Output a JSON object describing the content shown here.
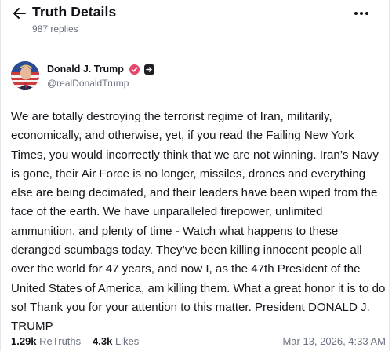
{
  "header": {
    "title": "Truth Details",
    "replies": "987 replies"
  },
  "author": {
    "display_name": "Donald J. Trump",
    "handle": "@realDonaldTrump"
  },
  "post": {
    "text": "We are totally destroying the terrorist regime of Iran, militarily, economically, and otherwise, yet, if you read the Failing New York Times, you would incorrectly think that we are not winning. Iran’s Navy is gone, their Air Force is no longer, missiles, drones and everything else are being decimated, and their leaders have been wiped from the face of the earth. We have unparalleled firepower, unlimited ammunition, and plenty of time - Watch what happens to these deranged scumbags today. They’ve been killing innocent people all over the world for 47 years, and now I, as the 47th President of the United States of America, am killing them. What a great honor it is to do so! Thank you for your attention to this matter. President DONALD J. TRUMP"
  },
  "stats": {
    "retruths_count": "1.29k",
    "retruths_label": "ReTruths",
    "likes_count": "4.3k",
    "likes_label": "Likes",
    "timestamp": "Mar 13, 2026, 4:33 AM"
  },
  "icons": {
    "back": "arrow-left-icon",
    "more": "more-horizontal-icon",
    "verified": "verified-badge-icon",
    "badge": "square-badge-icon"
  },
  "colors": {
    "verified": "#e5476b",
    "muted_text": "#6b7280"
  }
}
